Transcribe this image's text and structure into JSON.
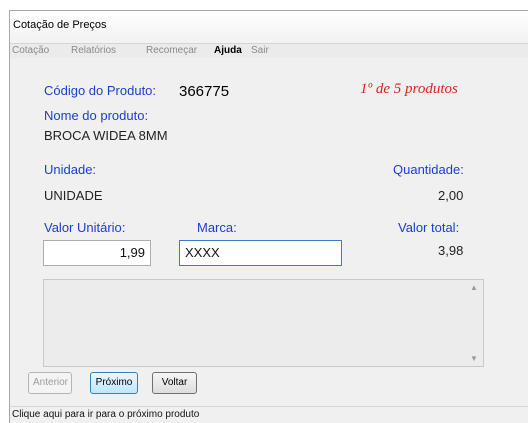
{
  "window": {
    "title": "Cotação de Preços"
  },
  "menu": [
    "Cotação",
    "Relatórios",
    "Recomeçar",
    "Ajuda",
    "Sair"
  ],
  "product": {
    "code_label": "Código do Produto:",
    "code_value": "366775",
    "counter": "1º de 5 produtos",
    "name_label": "Nome do produto:",
    "name_value": "BROCA WIDEA 8MM"
  },
  "unit": {
    "label": "Unidade:",
    "value": "UNIDADE"
  },
  "quantity": {
    "label": "Quantidade:",
    "value": "2,00"
  },
  "unit_price": {
    "label": "Valor Unitário:",
    "value": "1,99"
  },
  "brand": {
    "label": "Marca:",
    "value": "XXXX"
  },
  "total": {
    "label": "Valor total:",
    "value": "3,98"
  },
  "buttons": {
    "previous": "Anterior",
    "next": "Próximo",
    "back": "Voltar"
  },
  "status": "Clique aqui para ir para o próximo produto",
  "colors": {
    "label_blue": "#1c3dce",
    "counter_red": "#d9261c"
  }
}
